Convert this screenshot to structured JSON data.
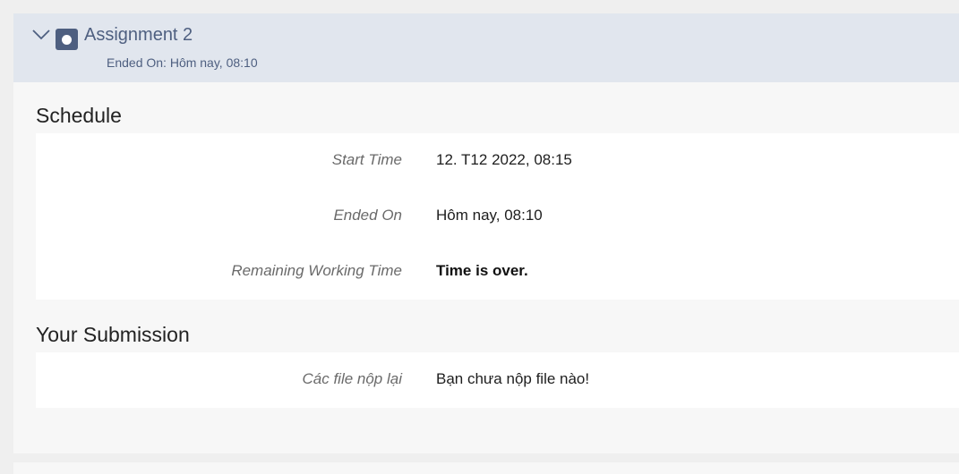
{
  "assignment": {
    "title": "Assignment 2",
    "ended_on_text": "Ended On: Hôm nay, 08:10",
    "icon": "assignment-icon",
    "toggle_icon": "chevron-down-icon"
  },
  "schedule": {
    "heading": "Schedule",
    "rows": [
      {
        "label": "Start Time",
        "value": "12. T12 2022, 08:15"
      },
      {
        "label": "Ended On",
        "value": "Hôm nay, 08:10"
      },
      {
        "label": "Remaining Working Time",
        "value": "Time is over."
      }
    ]
  },
  "submission": {
    "heading": "Your Submission",
    "rows": [
      {
        "label": "Các file nộp lại",
        "value": "Bạn chưa nộp file nào!"
      }
    ]
  },
  "colors": {
    "header_bg": "#e1e6ee",
    "accent": "#4e5f80"
  }
}
